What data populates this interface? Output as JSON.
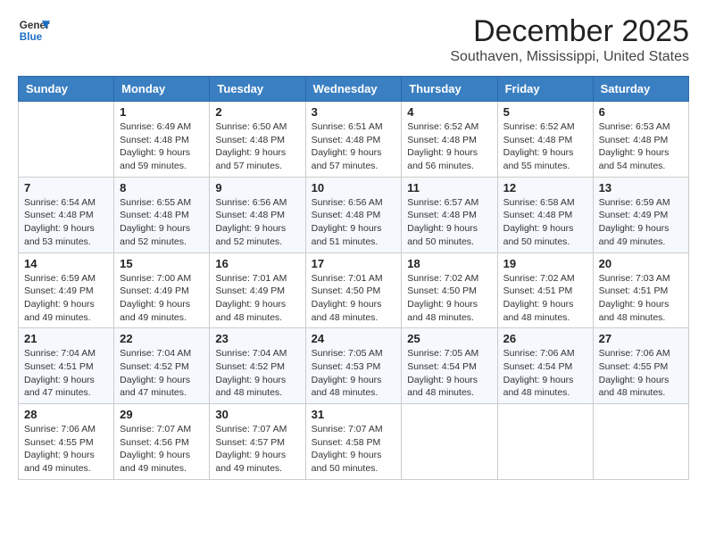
{
  "header": {
    "logo_line1": "General",
    "logo_line2": "Blue",
    "month": "December 2025",
    "location": "Southaven, Mississippi, United States"
  },
  "days_of_week": [
    "Sunday",
    "Monday",
    "Tuesday",
    "Wednesday",
    "Thursday",
    "Friday",
    "Saturday"
  ],
  "weeks": [
    [
      {
        "day": "",
        "info": ""
      },
      {
        "day": "1",
        "info": "Sunrise: 6:49 AM\nSunset: 4:48 PM\nDaylight: 9 hours\nand 59 minutes."
      },
      {
        "day": "2",
        "info": "Sunrise: 6:50 AM\nSunset: 4:48 PM\nDaylight: 9 hours\nand 57 minutes."
      },
      {
        "day": "3",
        "info": "Sunrise: 6:51 AM\nSunset: 4:48 PM\nDaylight: 9 hours\nand 57 minutes."
      },
      {
        "day": "4",
        "info": "Sunrise: 6:52 AM\nSunset: 4:48 PM\nDaylight: 9 hours\nand 56 minutes."
      },
      {
        "day": "5",
        "info": "Sunrise: 6:52 AM\nSunset: 4:48 PM\nDaylight: 9 hours\nand 55 minutes."
      },
      {
        "day": "6",
        "info": "Sunrise: 6:53 AM\nSunset: 4:48 PM\nDaylight: 9 hours\nand 54 minutes."
      }
    ],
    [
      {
        "day": "7",
        "info": "Sunrise: 6:54 AM\nSunset: 4:48 PM\nDaylight: 9 hours\nand 53 minutes."
      },
      {
        "day": "8",
        "info": "Sunrise: 6:55 AM\nSunset: 4:48 PM\nDaylight: 9 hours\nand 52 minutes."
      },
      {
        "day": "9",
        "info": "Sunrise: 6:56 AM\nSunset: 4:48 PM\nDaylight: 9 hours\nand 52 minutes."
      },
      {
        "day": "10",
        "info": "Sunrise: 6:56 AM\nSunset: 4:48 PM\nDaylight: 9 hours\nand 51 minutes."
      },
      {
        "day": "11",
        "info": "Sunrise: 6:57 AM\nSunset: 4:48 PM\nDaylight: 9 hours\nand 50 minutes."
      },
      {
        "day": "12",
        "info": "Sunrise: 6:58 AM\nSunset: 4:48 PM\nDaylight: 9 hours\nand 50 minutes."
      },
      {
        "day": "13",
        "info": "Sunrise: 6:59 AM\nSunset: 4:49 PM\nDaylight: 9 hours\nand 49 minutes."
      }
    ],
    [
      {
        "day": "14",
        "info": "Sunrise: 6:59 AM\nSunset: 4:49 PM\nDaylight: 9 hours\nand 49 minutes."
      },
      {
        "day": "15",
        "info": "Sunrise: 7:00 AM\nSunset: 4:49 PM\nDaylight: 9 hours\nand 49 minutes."
      },
      {
        "day": "16",
        "info": "Sunrise: 7:01 AM\nSunset: 4:49 PM\nDaylight: 9 hours\nand 48 minutes."
      },
      {
        "day": "17",
        "info": "Sunrise: 7:01 AM\nSunset: 4:50 PM\nDaylight: 9 hours\nand 48 minutes."
      },
      {
        "day": "18",
        "info": "Sunrise: 7:02 AM\nSunset: 4:50 PM\nDaylight: 9 hours\nand 48 minutes."
      },
      {
        "day": "19",
        "info": "Sunrise: 7:02 AM\nSunset: 4:51 PM\nDaylight: 9 hours\nand 48 minutes."
      },
      {
        "day": "20",
        "info": "Sunrise: 7:03 AM\nSunset: 4:51 PM\nDaylight: 9 hours\nand 48 minutes."
      }
    ],
    [
      {
        "day": "21",
        "info": "Sunrise: 7:04 AM\nSunset: 4:51 PM\nDaylight: 9 hours\nand 47 minutes."
      },
      {
        "day": "22",
        "info": "Sunrise: 7:04 AM\nSunset: 4:52 PM\nDaylight: 9 hours\nand 47 minutes."
      },
      {
        "day": "23",
        "info": "Sunrise: 7:04 AM\nSunset: 4:52 PM\nDaylight: 9 hours\nand 48 minutes."
      },
      {
        "day": "24",
        "info": "Sunrise: 7:05 AM\nSunset: 4:53 PM\nDaylight: 9 hours\nand 48 minutes."
      },
      {
        "day": "25",
        "info": "Sunrise: 7:05 AM\nSunset: 4:54 PM\nDaylight: 9 hours\nand 48 minutes."
      },
      {
        "day": "26",
        "info": "Sunrise: 7:06 AM\nSunset: 4:54 PM\nDaylight: 9 hours\nand 48 minutes."
      },
      {
        "day": "27",
        "info": "Sunrise: 7:06 AM\nSunset: 4:55 PM\nDaylight: 9 hours\nand 48 minutes."
      }
    ],
    [
      {
        "day": "28",
        "info": "Sunrise: 7:06 AM\nSunset: 4:55 PM\nDaylight: 9 hours\nand 49 minutes."
      },
      {
        "day": "29",
        "info": "Sunrise: 7:07 AM\nSunset: 4:56 PM\nDaylight: 9 hours\nand 49 minutes."
      },
      {
        "day": "30",
        "info": "Sunrise: 7:07 AM\nSunset: 4:57 PM\nDaylight: 9 hours\nand 49 minutes."
      },
      {
        "day": "31",
        "info": "Sunrise: 7:07 AM\nSunset: 4:58 PM\nDaylight: 9 hours\nand 50 minutes."
      },
      {
        "day": "",
        "info": ""
      },
      {
        "day": "",
        "info": ""
      },
      {
        "day": "",
        "info": ""
      }
    ]
  ]
}
